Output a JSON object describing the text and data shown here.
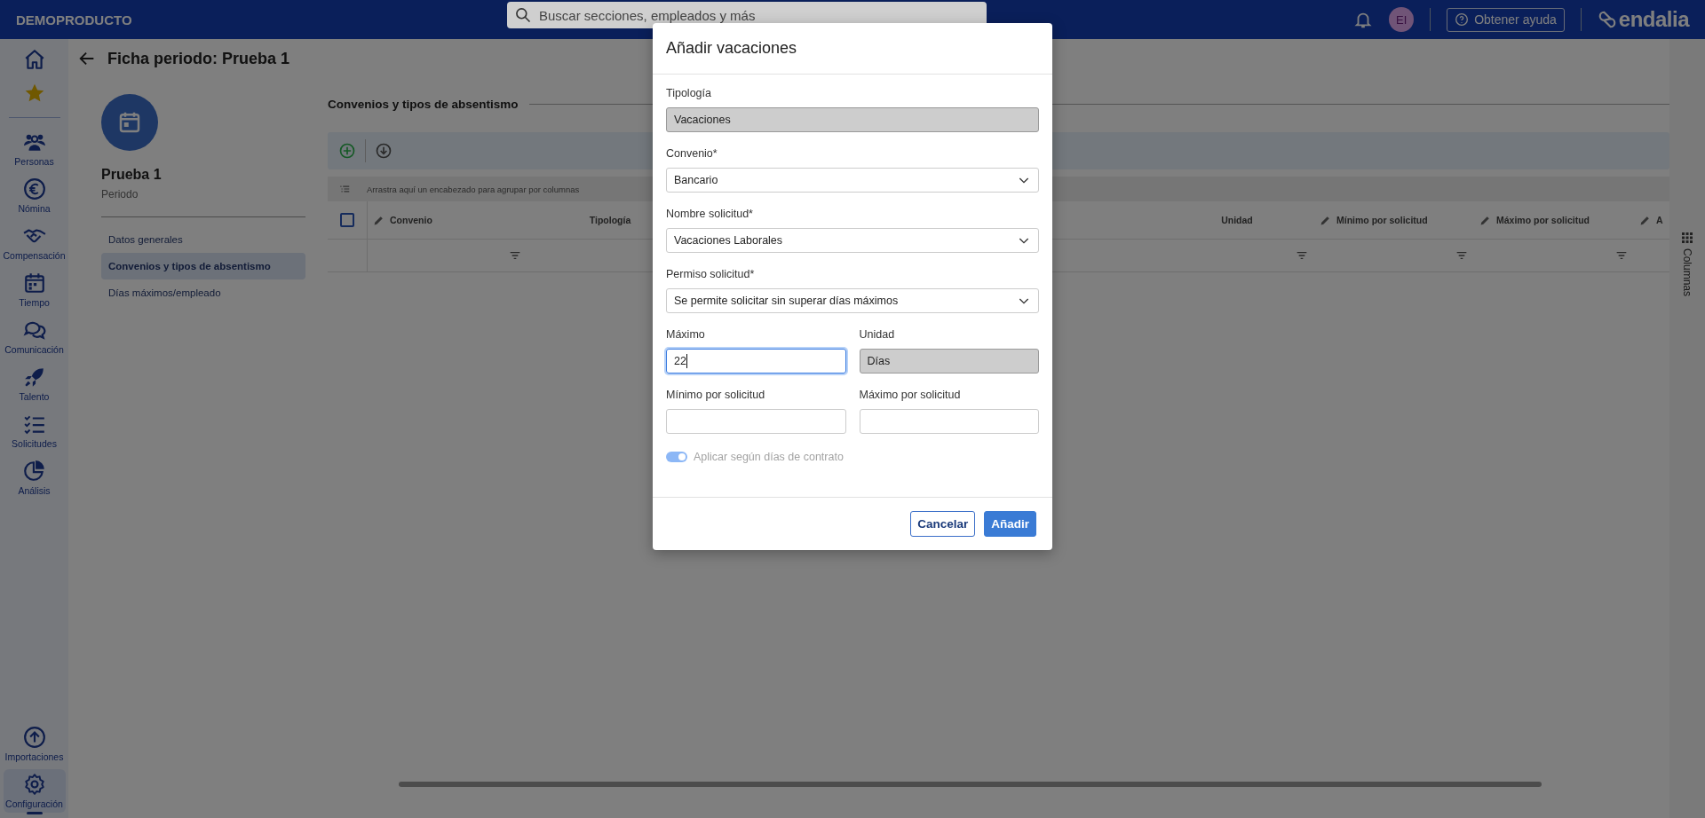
{
  "topbar": {
    "brand": "DEMOPRODUCTO",
    "search": {
      "placeholder": "Buscar secciones, empleados y más"
    },
    "avatar": "EI",
    "help": "Obtener ayuda",
    "logo": "endalia"
  },
  "nav": [
    {
      "selected": false
    },
    {
      "selected": false
    },
    {
      "label": "Personas",
      "selected": false
    },
    {
      "label": "Nómina",
      "selected": false
    },
    {
      "label": "Compensación",
      "selected": false
    },
    {
      "label": "Tiempo",
      "selected": false
    },
    {
      "label": "Comunicación",
      "selected": false
    },
    {
      "label": "Talento",
      "selected": false
    },
    {
      "label": "Solicitudes",
      "selected": false
    },
    {
      "label": "Análisis",
      "selected": false
    }
  ],
  "nav_bottom": [
    {
      "label": "Importaciones",
      "selected": false
    },
    {
      "label": "Configuración",
      "selected": true
    }
  ],
  "page": {
    "title": "Ficha periodo: Prueba 1",
    "entity": {
      "name": "Prueba 1",
      "type": "Periodo"
    },
    "menu": [
      {
        "label": "Datos generales",
        "selected": false
      },
      {
        "label": "Convenios y tipos de absentismo",
        "selected": true
      },
      {
        "label": "Días máximos/empleado",
        "selected": false
      }
    ]
  },
  "section": {
    "title": "Convenios y tipos de absentismo",
    "group_hint": "Arrastra aquí un encabezado para agrupar por columnas",
    "columns_panel": "Columnas",
    "select_all_checked": false,
    "columns": [
      {
        "label": "Convenio",
        "editable": true
      },
      {
        "label": "Tipología",
        "editable": false
      },
      {
        "label": "Unidad",
        "editable": false
      },
      {
        "label": "Mínimo por solicitud",
        "editable": true
      },
      {
        "label": "Máximo por solicitud",
        "editable": true
      },
      {
        "label": "A",
        "editable": true
      }
    ]
  },
  "dialog": {
    "title": "Añadir vacaciones",
    "rows": [
      [
        {
          "label": "Tipología",
          "kind": "readonly",
          "value": "Vacaciones",
          "focused": false
        }
      ],
      [
        {
          "label": "Convenio*",
          "kind": "select",
          "value": "Bancario",
          "focused": false
        }
      ],
      [
        {
          "label": "Nombre solicitud*",
          "kind": "select",
          "value": "Vacaciones Laborales",
          "focused": false
        }
      ],
      [
        {
          "label": "Permiso solicitud*",
          "kind": "select",
          "value": "Se permite solicitar sin superar días máximos",
          "focused": false
        }
      ],
      [
        {
          "label": "Máximo",
          "kind": "input",
          "value": "22",
          "focused": true
        },
        {
          "label": "Unidad",
          "kind": "readonly",
          "value": "Días",
          "focused": false
        }
      ],
      [
        {
          "label": "Mínimo por solicitud",
          "kind": "input",
          "focused": false
        },
        {
          "label": "Máximo por solicitud",
          "kind": "input",
          "focused": false
        }
      ]
    ],
    "toggle": {
      "label": "Aplicar según días de contrato",
      "on": true,
      "disabled": true
    },
    "buttons": [
      {
        "label": "Cancelar",
        "kind": "secondary"
      },
      {
        "label": "Añadir",
        "kind": "primary"
      }
    ]
  }
}
